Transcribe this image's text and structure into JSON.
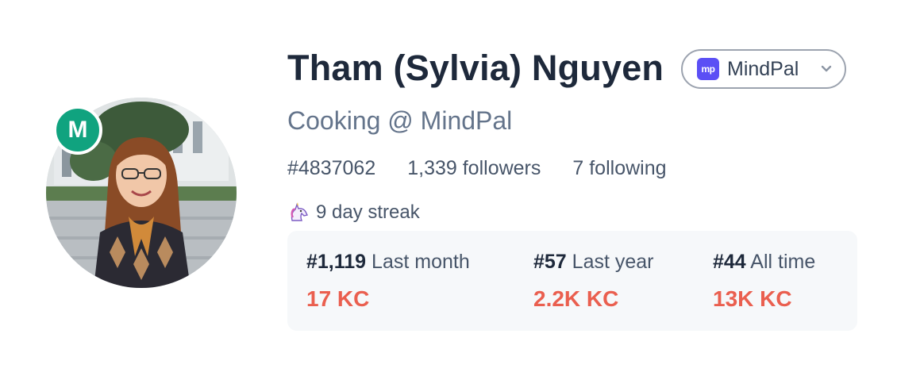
{
  "profile": {
    "avatar_badge": "M",
    "name": "Tham (Sylvia) Nguyen",
    "headline": "Cooking @ MindPal"
  },
  "org_select": {
    "logo_text": "mp",
    "selected": "MindPal",
    "logo_color": "#5b4ff5"
  },
  "stats": {
    "rank": "#4837062",
    "followers": "1,339 followers",
    "following": "7 following"
  },
  "streak": {
    "icon": "unicorn-icon",
    "text": "9 day streak"
  },
  "rankings": [
    {
      "rank": "#1,119",
      "period": "Last month",
      "value": "17 KC"
    },
    {
      "rank": "#57",
      "period": "Last year",
      "value": "2.2K KC"
    },
    {
      "rank": "#44",
      "period": "All time",
      "value": "13K KC"
    }
  ],
  "colors": {
    "badge": "#10a37f",
    "kc_value": "#ea5f4f",
    "card_bg": "#f6f8fa"
  }
}
